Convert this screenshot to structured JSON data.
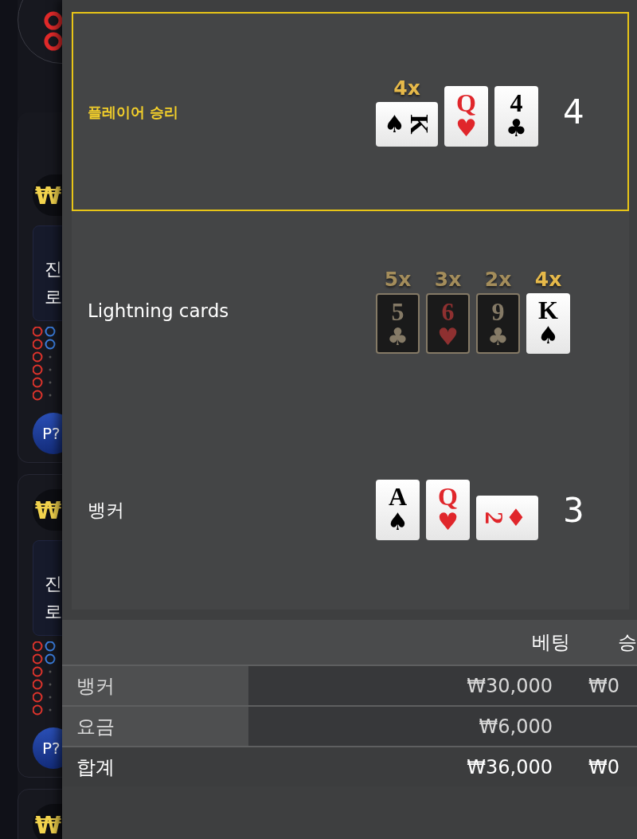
{
  "lobby_tiles": [
    {
      "currency": "₩",
      "message_lines": [
        "진",
        "로"
      ],
      "badge": "P?"
    },
    {
      "currency": "₩",
      "message_lines": [
        "진",
        "로"
      ],
      "badge": "P?"
    },
    {
      "currency": "₩"
    }
  ],
  "results": [
    {
      "label": "플레이어 승리",
      "winner": true,
      "score": "4",
      "cards": [
        {
          "rank": "K",
          "suit": "♠",
          "red": false,
          "sideways": true,
          "suit_first": true,
          "multiplier": "4x"
        },
        {
          "rank": "Q",
          "suit": "♥",
          "red": true,
          "sideways": false
        },
        {
          "rank": "4",
          "suit": "♣",
          "red": false,
          "sideways": false
        }
      ]
    },
    {
      "label": "Lightning cards",
      "cards": [
        {
          "rank": "5",
          "suit": "♣",
          "red": false,
          "sideways": false,
          "dimmed": true,
          "multiplier": "5x"
        },
        {
          "rank": "6",
          "suit": "♥",
          "red": true,
          "sideways": false,
          "dimmed": true,
          "multiplier": "3x"
        },
        {
          "rank": "9",
          "suit": "♣",
          "red": false,
          "sideways": false,
          "dimmed": true,
          "multiplier": "2x"
        },
        {
          "rank": "K",
          "suit": "♠",
          "red": false,
          "sideways": false,
          "dimmed": false,
          "multiplier": "4x"
        }
      ]
    },
    {
      "label": "뱅커",
      "score": "3",
      "cards": [
        {
          "rank": "A",
          "suit": "♠",
          "red": false,
          "sideways": false
        },
        {
          "rank": "Q",
          "suit": "♥",
          "red": true,
          "sideways": false
        },
        {
          "rank": "2",
          "suit": "♦",
          "red": true,
          "sideways": true,
          "suit_first": false
        }
      ]
    }
  ],
  "bet_table": {
    "columns": [
      "베팅",
      "승"
    ],
    "rows": [
      {
        "label": "뱅커",
        "bet": "₩30,000",
        "win": "₩0",
        "kind": "line"
      },
      {
        "label": "요금",
        "bet": "₩6,000",
        "kind": "line"
      },
      {
        "label": "합계",
        "bet": "₩36,000",
        "win": "₩0",
        "kind": "total"
      }
    ]
  }
}
